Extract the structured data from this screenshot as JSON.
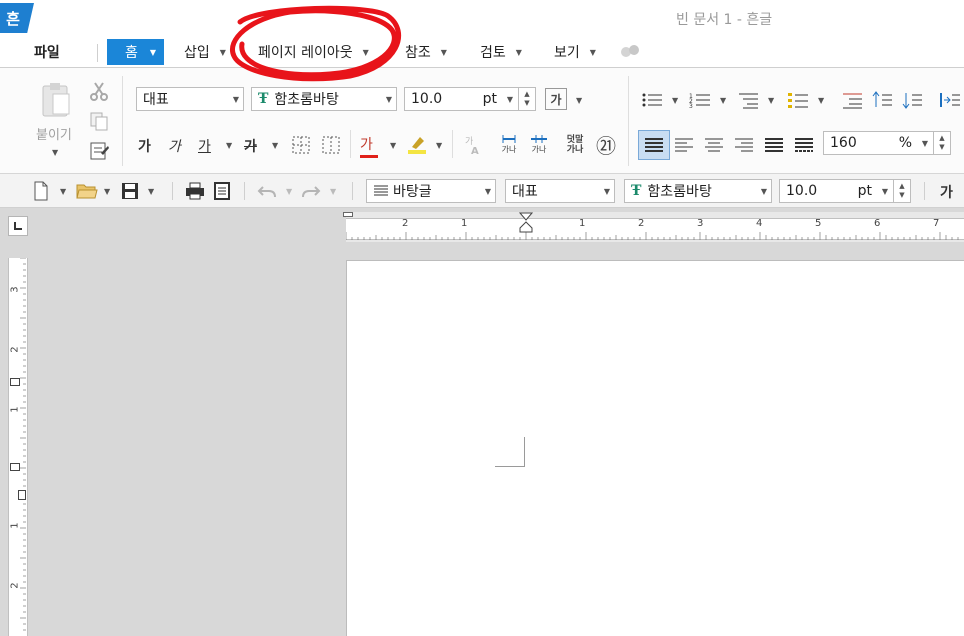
{
  "app": {
    "logo_text": "흔",
    "title": "빈 문서 1 - 흔글"
  },
  "menu": {
    "file": "파일",
    "tabs": [
      {
        "label": "홈"
      },
      {
        "label": "삽입"
      },
      {
        "label": "페이지 레이아웃"
      },
      {
        "label": "참조"
      },
      {
        "label": "검토"
      },
      {
        "label": "보기"
      }
    ]
  },
  "ribbon": {
    "paste_label": "붙이기",
    "style_combo": "대표",
    "font_combo": "함초롬바탕",
    "size_value": "10.0",
    "size_unit": "pt",
    "char_shape_glyph": "가",
    "bold_glyph": "가",
    "italic_glyph": "가",
    "underline_glyph": "가",
    "strike_glyph": "가",
    "font_color_glyph": "가",
    "char_spacing_a": "가나",
    "char_spacing_b": "가나",
    "char_over_top": "덧말",
    "char_over_bottom": "가나",
    "circled_num": "㉑",
    "line_spacing_value": "160",
    "line_spacing_unit": "%"
  },
  "quick": {
    "para_style": "바탕글",
    "style_combo": "대표",
    "font_combo": "함초롬바탕",
    "size_value": "10.0",
    "size_unit": "pt",
    "char_glyph": "가"
  },
  "rulers": {
    "h_labels": [
      "2",
      "1",
      "1",
      "2",
      "3",
      "4",
      "5",
      "6",
      "7"
    ],
    "v_labels": [
      "3",
      "2",
      "1",
      "1",
      "2"
    ]
  },
  "colors": {
    "accent": "#1b86d8",
    "annotation": "#e8141a",
    "logo": "#1e7fd0"
  }
}
